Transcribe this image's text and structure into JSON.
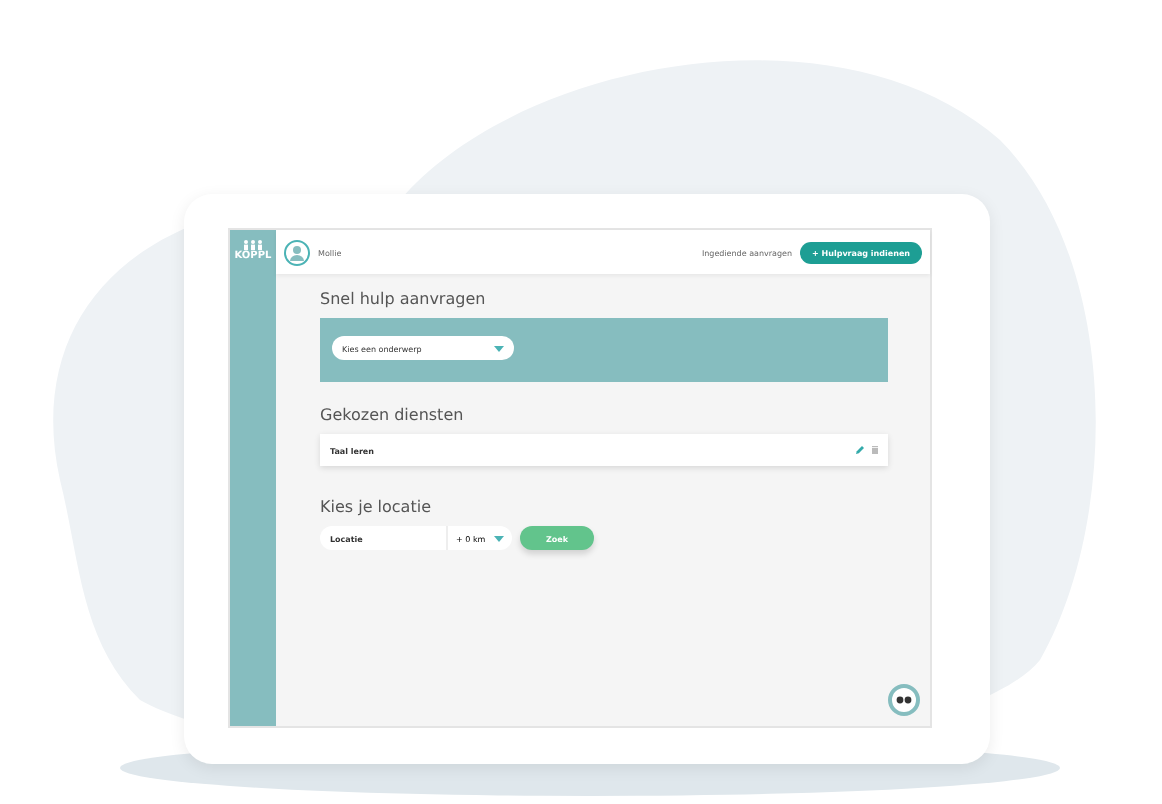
{
  "sidebar": {
    "logo": "KOPPL"
  },
  "header": {
    "user": "Mollie",
    "link": "Ingediende aanvragen",
    "button": "+ Hulpvraag indienen"
  },
  "quick_help": {
    "title": "Snel hulp aanvragen",
    "select": "Kies een onderwerp"
  },
  "services": {
    "title": "Gekozen diensten",
    "items": [
      {
        "label": "Taal leren"
      }
    ]
  },
  "location": {
    "title": "Kies je locatie",
    "placeholder": "Locatie",
    "distance": "+ 0 km",
    "button": "Zoek"
  }
}
